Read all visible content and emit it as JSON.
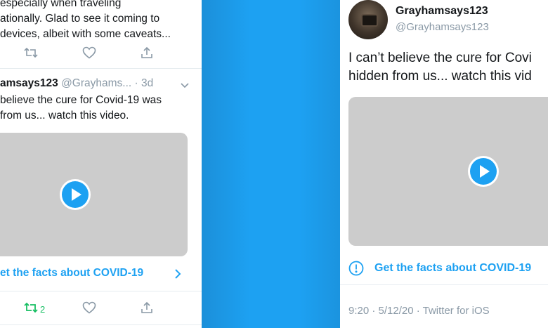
{
  "left_tweet": {
    "text_lines": [
      "especially when traveling",
      "ationally. Glad to see it coming to",
      "devices, albeit with some caveats..."
    ],
    "likes_count": ""
  },
  "left_tweet2": {
    "name": "amsays123",
    "handle_time": "@Grayhams... · 3d",
    "text_lines": [
      "believe the cure for Covid-19 was",
      "from us... watch this video."
    ],
    "facts_link": "et the facts about COVID-19",
    "retweet_count": "2"
  },
  "right_tweet": {
    "name": "Grayhamsays123",
    "handle": "@Grayhamsays123",
    "text_lines": [
      "I can’t believe the cure for Covi",
      "hidden from us... watch this vid"
    ],
    "facts_link": "Get the facts about COVID-19",
    "meta": "9:20 · 5/12/20 · Twitter for iOS"
  },
  "colors": {
    "brand_blue": "#1da1f2",
    "retweet_green": "#17bf63",
    "muted_gray": "#8a99a6",
    "video_gray": "#cccccc"
  },
  "icons": [
    "retweet-icon",
    "heart-icon",
    "share-icon",
    "chevron-down-icon",
    "chevron-right-icon",
    "play-icon",
    "info-circle-icon"
  ]
}
